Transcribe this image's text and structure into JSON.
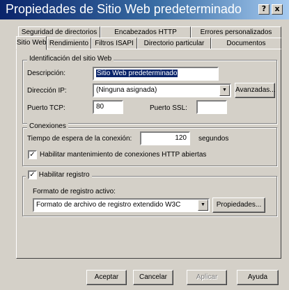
{
  "window": {
    "title": "Propiedades de Sitio Web predeterminado",
    "help_label": "?",
    "close_label": "x"
  },
  "tabs_row1": [
    {
      "label": "Seguridad de directorios"
    },
    {
      "label": "Encabezados HTTP"
    },
    {
      "label": "Errores personalizados"
    }
  ],
  "tabs_row2": [
    {
      "label": "Sitio Web",
      "selected": true
    },
    {
      "label": "Rendimiento"
    },
    {
      "label": "Filtros ISAPI"
    },
    {
      "label": "Directorio particular"
    },
    {
      "label": "Documentos"
    }
  ],
  "identification": {
    "title": "Identificación del sitio Web",
    "description_label": "Descripción:",
    "description_value": "Sitio Web predeterminado",
    "ip_label": "Dirección IP:",
    "ip_value": "(Ninguna asignada)",
    "advanced_label": "Avanzadas...",
    "tcp_label": "Puerto TCP:",
    "tcp_value": "80",
    "ssl_label": "Puerto SSL:",
    "ssl_value": ""
  },
  "connections": {
    "title": "Conexiones",
    "timeout_label": "Tiempo de espera de la conexión:",
    "timeout_value": "120",
    "timeout_unit": "segundos",
    "keepalive_label": "Habilitar mantenimiento de conexiones HTTP abiertas",
    "keepalive_checked": true
  },
  "logging": {
    "enable_label": "Habilitar registro",
    "enable_checked": true,
    "format_label": "Formato de registro activo:",
    "format_value": "Formato de archivo de registro extendido W3C",
    "properties_label": "Propiedades..."
  },
  "footer": {
    "accept_label": "Aceptar",
    "cancel_label": "Cancelar",
    "apply_label": "Aplicar",
    "help_label": "Ayuda"
  }
}
